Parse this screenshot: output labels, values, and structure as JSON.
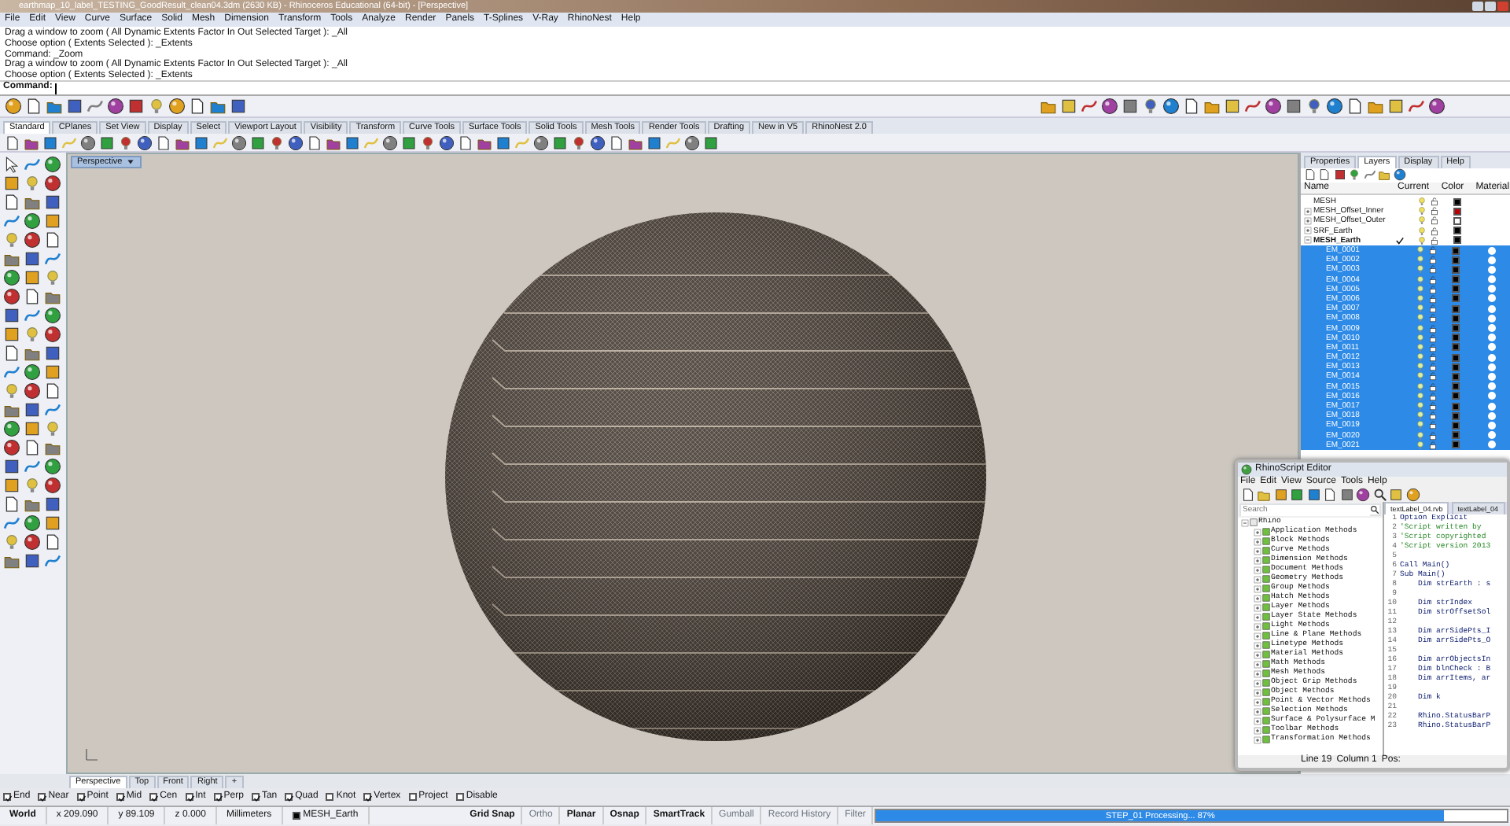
{
  "window": {
    "title": "earthmap_10_label_TESTING_GoodResult_clean04.3dm (2630 KB) - Rhinoceros Educational (64-bit) - [Perspective]"
  },
  "menu": [
    "File",
    "Edit",
    "View",
    "Curve",
    "Surface",
    "Solid",
    "Mesh",
    "Dimension",
    "Transform",
    "Tools",
    "Analyze",
    "Render",
    "Panels",
    "T-Splines",
    "V-Ray",
    "RhinoNest",
    "Help"
  ],
  "command_history": [
    "Drag a window to zoom ( All Dynamic Extents Factor In Out Selected Target ): _All",
    "Choose option ( Extents Selected ): _Extents",
    "Command: _Zoom",
    "Drag a window to zoom ( All Dynamic Extents Factor In Out Selected Target ): _All",
    "Choose option ( Extents Selected ): _Extents"
  ],
  "command_prompt": "Command:",
  "toolbar_tabs": [
    {
      "label": "Standard",
      "selected": true
    },
    {
      "label": "CPlanes",
      "selected": false
    },
    {
      "label": "Set View",
      "selected": false
    },
    {
      "label": "Display",
      "selected": false
    },
    {
      "label": "Select",
      "selected": false
    },
    {
      "label": "Viewport Layout",
      "selected": false
    },
    {
      "label": "Visibility",
      "selected": false
    },
    {
      "label": "Transform",
      "selected": false
    },
    {
      "label": "Curve Tools",
      "selected": false
    },
    {
      "label": "Surface Tools",
      "selected": false
    },
    {
      "label": "Solid Tools",
      "selected": false
    },
    {
      "label": "Mesh Tools",
      "selected": false
    },
    {
      "label": "Render Tools",
      "selected": false
    },
    {
      "label": "Drafting",
      "selected": false
    },
    {
      "label": "New in V5",
      "selected": false
    },
    {
      "label": "RhinoNest 2.0",
      "selected": false
    }
  ],
  "viewport": {
    "title": "Perspective"
  },
  "viewport_tabs": [
    {
      "label": "Perspective",
      "selected": true
    },
    {
      "label": "Top",
      "selected": false
    },
    {
      "label": "Front",
      "selected": false
    },
    {
      "label": "Right",
      "selected": false
    },
    {
      "label": "+",
      "selected": false
    }
  ],
  "osnaps": [
    {
      "label": "End",
      "checked": true
    },
    {
      "label": "Near",
      "checked": true
    },
    {
      "label": "Point",
      "checked": true
    },
    {
      "label": "Mid",
      "checked": true
    },
    {
      "label": "Cen",
      "checked": true
    },
    {
      "label": "Int",
      "checked": true
    },
    {
      "label": "Perp",
      "checked": true
    },
    {
      "label": "Tan",
      "checked": true
    },
    {
      "label": "Quad",
      "checked": true
    },
    {
      "label": "Knot",
      "checked": false
    },
    {
      "label": "Vertex",
      "checked": true
    },
    {
      "label": "Project",
      "checked": false
    },
    {
      "label": "Disable",
      "checked": false
    }
  ],
  "panel": {
    "tabs": [
      {
        "label": "Properties",
        "selected": false
      },
      {
        "label": "Layers",
        "selected": true
      },
      {
        "label": "Display",
        "selected": false
      },
      {
        "label": "Help",
        "selected": false
      }
    ],
    "columns": [
      "Name",
      "Current",
      "Color",
      "Material"
    ],
    "layers": [
      {
        "name": "MESH",
        "current": false,
        "color": "#000000"
      },
      {
        "name": "MESH_Offset_Inner",
        "expanded": false,
        "current": false,
        "color": "#c00000"
      },
      {
        "name": "MESH_Offset_Outer",
        "expanded": false,
        "current": false,
        "color": "#ffffff"
      },
      {
        "name": "SRF_Earth",
        "expanded": false,
        "current": false,
        "color": "#000000"
      },
      {
        "name": "MESH_Earth",
        "expanded": true,
        "current": true,
        "color": "#000000",
        "children": [
          {
            "name": "EM_0001",
            "selected": true,
            "color": "#000000"
          },
          {
            "name": "EM_0002",
            "selected": true,
            "color": "#000000"
          },
          {
            "name": "EM_0003",
            "selected": true,
            "color": "#000000"
          },
          {
            "name": "EM_0004",
            "selected": true,
            "color": "#000000"
          },
          {
            "name": "EM_0005",
            "selected": true,
            "color": "#000000"
          },
          {
            "name": "EM_0006",
            "selected": true,
            "color": "#000000"
          },
          {
            "name": "EM_0007",
            "selected": true,
            "color": "#000000"
          },
          {
            "name": "EM_0008",
            "selected": true,
            "color": "#000000"
          },
          {
            "name": "EM_0009",
            "selected": true,
            "color": "#000000"
          },
          {
            "name": "EM_0010",
            "selected": true,
            "color": "#000000"
          },
          {
            "name": "EM_0011",
            "selected": true,
            "color": "#000000"
          },
          {
            "name": "EM_0012",
            "selected": true,
            "color": "#000000"
          },
          {
            "name": "EM_0013",
            "selected": true,
            "color": "#000000"
          },
          {
            "name": "EM_0014",
            "selected": true,
            "color": "#000000"
          },
          {
            "name": "EM_0015",
            "selected": true,
            "color": "#000000"
          },
          {
            "name": "EM_0016",
            "selected": true,
            "color": "#000000"
          },
          {
            "name": "EM_0017",
            "selected": true,
            "color": "#000000"
          },
          {
            "name": "EM_0018",
            "selected": true,
            "color": "#000000"
          },
          {
            "name": "EM_0019",
            "selected": true,
            "color": "#000000"
          },
          {
            "name": "EM_0020",
            "selected": true,
            "color": "#000000"
          },
          {
            "name": "EM_0021",
            "selected": true,
            "color": "#000000"
          }
        ]
      }
    ]
  },
  "script_editor": {
    "title": "RhinoScript Editor",
    "menu": [
      "File",
      "Edit",
      "View",
      "Source",
      "Tools",
      "Help"
    ],
    "search": {
      "placeholder": "Search"
    },
    "tree": {
      "label": "Rhino",
      "expanded": true,
      "children": [
        {
          "label": "Application Methods"
        },
        {
          "label": "Block Methods"
        },
        {
          "label": "Curve Methods"
        },
        {
          "label": "Dimension Methods"
        },
        {
          "label": "Document Methods"
        },
        {
          "label": "Geometry Methods"
        },
        {
          "label": "Group Methods"
        },
        {
          "label": "Hatch Methods"
        },
        {
          "label": "Layer Methods"
        },
        {
          "label": "Layer State Methods"
        },
        {
          "label": "Light Methods"
        },
        {
          "label": "Line & Plane Methods"
        },
        {
          "label": "Linetype Methods"
        },
        {
          "label": "Material Methods"
        },
        {
          "label": "Math Methods"
        },
        {
          "label": "Mesh Methods"
        },
        {
          "label": "Object Grip Methods"
        },
        {
          "label": "Object Methods"
        },
        {
          "label": "Point & Vector Methods"
        },
        {
          "label": "Selection Methods"
        },
        {
          "label": "Surface & Polysurface M"
        },
        {
          "label": "Toolbar Methods"
        },
        {
          "label": "Transformation Methods"
        }
      ]
    },
    "tabs": [
      {
        "label": "textLabel_04.rvb",
        "selected": true
      },
      {
        "label": "textLabel_04",
        "selected": false
      }
    ],
    "code": [
      {
        "number": "1",
        "kind": "code",
        "text": "Option Explicit"
      },
      {
        "number": "2",
        "kind": "comment",
        "text": "'Script written by"
      },
      {
        "number": "3",
        "kind": "comment",
        "text": "'Script copyrighted"
      },
      {
        "number": "4",
        "kind": "comment",
        "text": "'Script version 2013"
      },
      {
        "number": "5"
      },
      {
        "number": "6",
        "kind": "code",
        "text": "Call Main()"
      },
      {
        "number": "7",
        "kind": "code",
        "text": "Sub Main()"
      },
      {
        "number": "8",
        "kind": "code",
        "text": "    Dim strEarth : s"
      },
      {
        "number": "9"
      },
      {
        "number": "10",
        "kind": "code",
        "text": "    Dim strIndex"
      },
      {
        "number": "11",
        "kind": "code",
        "text": "    Dim strOffsetSol"
      },
      {
        "number": "12"
      },
      {
        "number": "13",
        "kind": "code",
        "text": "    Dim arrSidePts_I"
      },
      {
        "number": "14",
        "kind": "code",
        "text": "    Dim arrSidePts_O"
      },
      {
        "number": "15"
      },
      {
        "number": "16",
        "kind": "code",
        "text": "    Dim arrObjectsIn"
      },
      {
        "number": "17",
        "kind": "code",
        "text": "    Dim blnCheck : B"
      },
      {
        "number": "18",
        "kind": "code",
        "text": "    Dim arrItems, ar"
      },
      {
        "number": "19"
      },
      {
        "number": "20",
        "kind": "code",
        "text": "    Dim k"
      },
      {
        "number": "21"
      },
      {
        "number": "22",
        "kind": "code",
        "text": "    Rhino.StatusBarP"
      },
      {
        "number": "23",
        "kind": "code",
        "text": "    Rhino.StatusBarP"
      }
    ],
    "status": [
      "Line 19",
      "Column 1",
      "Pos:"
    ]
  },
  "status_bar": {
    "cplane": "World",
    "x": "x 209.090",
    "y": "y 89.109",
    "z": "z 0.000",
    "units": "Millimeters",
    "layer": {
      "name": "MESH_Earth",
      "color": "#000000"
    },
    "toggles": [
      {
        "label": "Grid Snap",
        "on": true
      },
      {
        "label": "Ortho",
        "on": false
      },
      {
        "label": "Planar",
        "on": true
      },
      {
        "label": "Osnap",
        "on": true
      },
      {
        "label": "SmartTrack",
        "on": true
      },
      {
        "label": "Gumball",
        "on": false
      },
      {
        "label": "Record History",
        "on": false
      },
      {
        "label": "Filter",
        "on": false
      }
    ],
    "progress": {
      "label": "STEP_01 Processing... 87%",
      "level": 0.9
    }
  }
}
